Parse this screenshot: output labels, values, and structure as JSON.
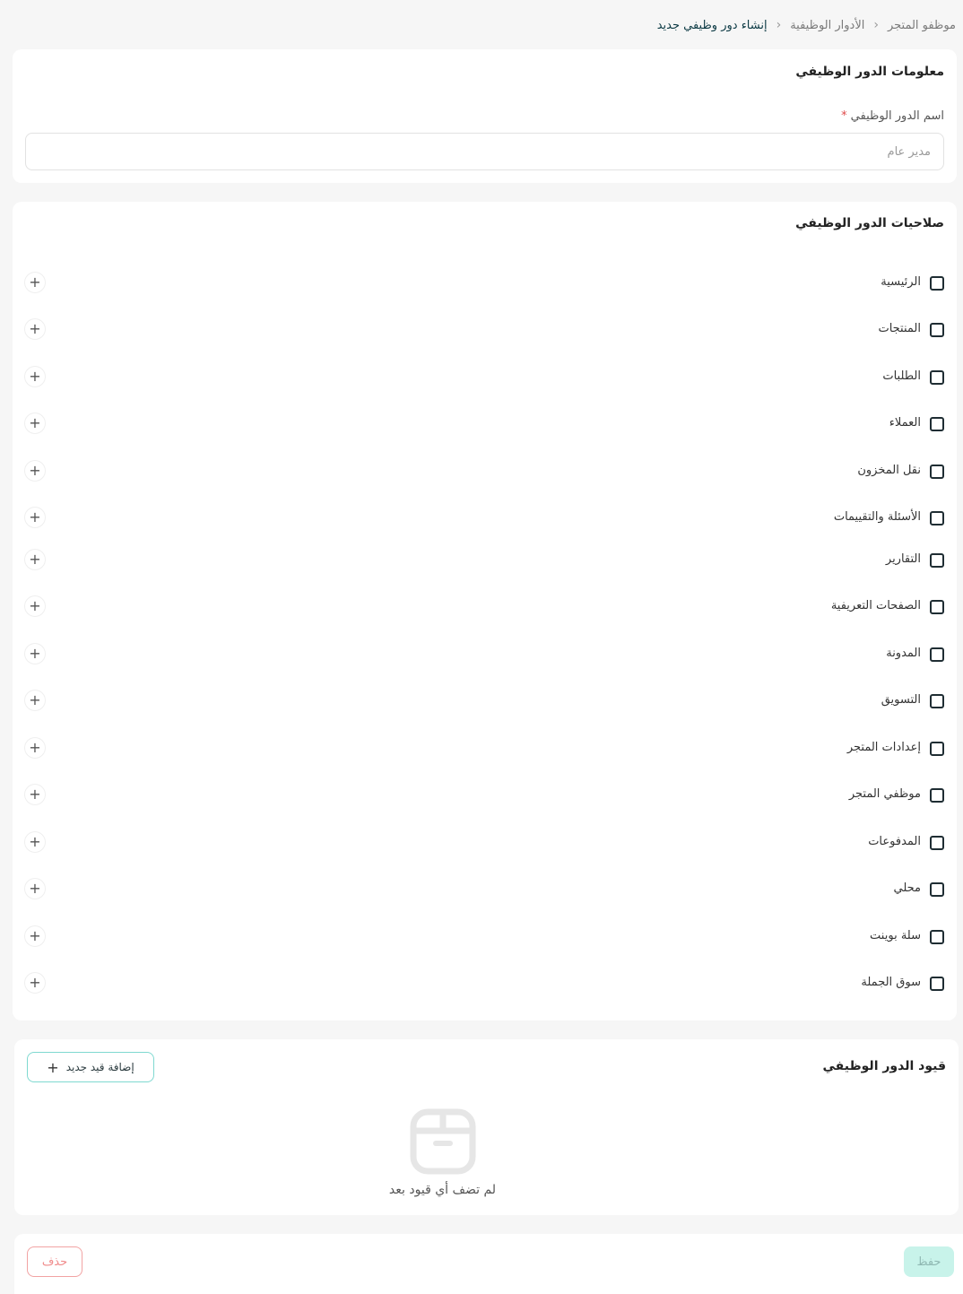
{
  "breadcrumb": {
    "items": [
      "موظفو المتجر",
      "الأدوار الوظيفية",
      "إنشاء دور وظيفي جديد"
    ],
    "separator": "›"
  },
  "role_info": {
    "title": "معلومات الدور الوظيفي",
    "name_label": "اسم الدور الوظيفي",
    "required_mark": "*",
    "name_placeholder": "مدير عام",
    "name_value": ""
  },
  "permissions": {
    "title": "صلاحيات الدور الوظيفي",
    "expand_symbol": "+",
    "items": [
      {
        "label": "الرئيسية",
        "checked": false
      },
      {
        "label": "المنتجات",
        "checked": false
      },
      {
        "label": "الطلبات",
        "checked": false
      },
      {
        "label": "العملاء",
        "checked": false
      },
      {
        "label": "نقل المخزون",
        "checked": false
      },
      {
        "label": "الأسئلة والتقييمات",
        "checked": false
      },
      {
        "label": "التقارير",
        "checked": false
      },
      {
        "label": "الصفحات التعريفية",
        "checked": false
      },
      {
        "label": "المدونة",
        "checked": false
      },
      {
        "label": "التسويق",
        "checked": false
      },
      {
        "label": "إعدادات المتجر",
        "checked": false
      },
      {
        "label": "موظفي المتجر",
        "checked": false
      },
      {
        "label": "المدفوعات",
        "checked": false
      },
      {
        "label": "محلي",
        "checked": false
      },
      {
        "label": "سلة بوينت",
        "checked": false
      },
      {
        "label": "سوق الجملة",
        "checked": false
      }
    ]
  },
  "constraints": {
    "title": "قيود الدور الوظيفي",
    "add_label": "إضافة قيد جديد",
    "add_symbol": "+",
    "empty_text": "لم تضف أي قيود بعد",
    "empty_icon": "box-icon"
  },
  "actions": {
    "save_label": "حفظ",
    "delete_label": "حذف"
  },
  "colors": {
    "accent": "#7fd9d0",
    "save_bg": "#c8f3ea",
    "danger": "#f08c8c",
    "required": "#e04b4b"
  }
}
